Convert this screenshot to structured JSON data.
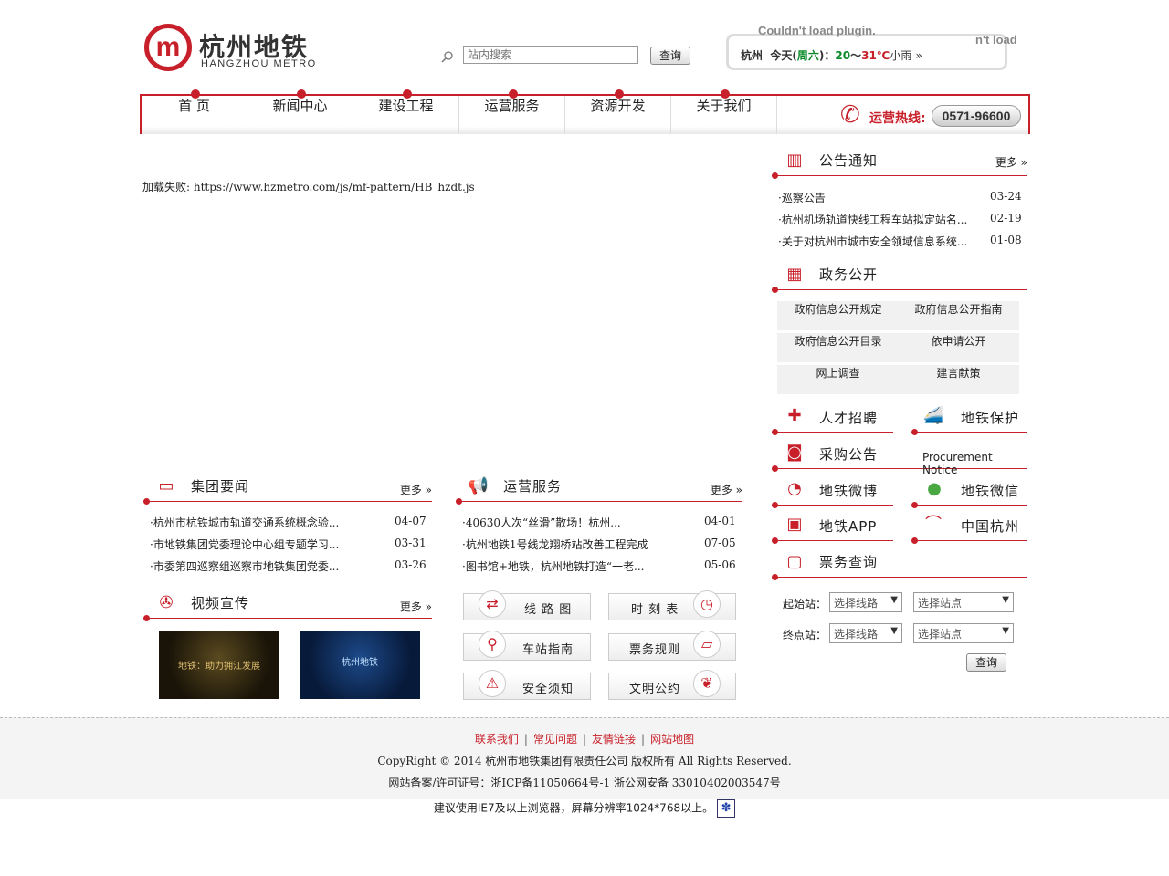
{
  "header": {
    "logo_cn": "杭州地铁",
    "logo_en": "HANGZHOU METRO",
    "search_placeholder": "站内搜索",
    "search_button": "查询",
    "plugin_error": "Couldn't load plugin.",
    "plugin_error_partial": "n't load",
    "weather": {
      "city": "杭州",
      "today": "今天(",
      "weekday": "周六",
      "close": ")：",
      "low": "20",
      "tilde": "～",
      "high": "31℃",
      "condition": "小雨",
      "chevron": "»"
    }
  },
  "nav": {
    "items": [
      "首 页",
      "新闻中心",
      "建设工程",
      "运营服务",
      "资源开发",
      "关于我们"
    ],
    "hotline_label": "运营热线:",
    "hotline_number": "0571-96600"
  },
  "main": {
    "load_fail": "加载失败: https://www.hzmetro.com/js/mf-pattern/HB_hzdt.js"
  },
  "group_news": {
    "title": "集团要闻",
    "more": "更多 »",
    "items": [
      {
        "text": "·杭州市杭铁城市轨道交通系统概念验...",
        "date": "04-07"
      },
      {
        "text": "·市地铁集团党委理论中心组专题学习...",
        "date": "03-31"
      },
      {
        "text": "·市委第四巡察组巡察市地铁集团党委...",
        "date": "03-26"
      }
    ]
  },
  "ops_service": {
    "title": "运营服务",
    "more": "更多 »",
    "items": [
      {
        "text": "·40630人次“丝滑”散场！杭州...",
        "date": "04-01"
      },
      {
        "text": "·杭州地铁1号线龙翔桥站改善工程完成",
        "date": "07-05"
      },
      {
        "text": "·图书馆+地铁，杭州地铁打造“一老...",
        "date": "05-06"
      }
    ]
  },
  "video": {
    "title": "视频宣传",
    "more": "更多 »",
    "thumbs": [
      {
        "caption": "地铁：助力拥江发展"
      },
      {
        "caption": "杭州地铁"
      }
    ]
  },
  "service_buttons": [
    {
      "label": "线 路 图",
      "icon": "route-icon"
    },
    {
      "label": "时 刻 表",
      "icon": "clock-icon"
    },
    {
      "label": "车站指南",
      "icon": "location-pin-icon"
    },
    {
      "label": "票务规则",
      "icon": "ticket-icon"
    },
    {
      "label": "安全须知",
      "icon": "safety-icon"
    },
    {
      "label": "文明公约",
      "icon": "handshake-icon"
    }
  ],
  "notice": {
    "title": "公告通知",
    "more": "更多 »",
    "items": [
      {
        "text": "·巡察公告",
        "date": "03-24"
      },
      {
        "text": "·杭州机场轨道快线工程车站拟定站名...",
        "date": "02-19"
      },
      {
        "text": "·关于对杭州市城市安全领域信息系统...",
        "date": "01-08"
      }
    ]
  },
  "gov": {
    "title": "政务公开",
    "cells": [
      "政府信息公开规定",
      "政府信息公开指南",
      "政府信息公开目录",
      "依申请公开",
      "网上调查",
      "建言献策"
    ]
  },
  "side_links": {
    "recruit": "人才招聘",
    "protect": "地铁保护",
    "procure": "采购公告",
    "procure_en": "Procurement Notice",
    "weibo": "地铁微博",
    "wechat": "地铁微信",
    "app": "地铁APP",
    "china_hz": "中国杭州"
  },
  "ticket": {
    "title": "票务查询",
    "start_label": "起始站：",
    "end_label": "终点站：",
    "line_select": "选择线路",
    "station_select": "选择站点",
    "query": "查询"
  },
  "footer": {
    "links": [
      "联系我们",
      "常见问题",
      "友情链接",
      "网站地图"
    ],
    "copyright": "CopyRight © 2014 杭州市地铁集团有限责任公司 版权所有 All Rights Reserved.",
    "icp": "网站备案/许可证号：浙ICP备11050664号-1   浙公网安备 33010402003547号",
    "browser_tip": "建议使用IE7及以上浏览器，屏幕分辨率1024*768以上。"
  }
}
